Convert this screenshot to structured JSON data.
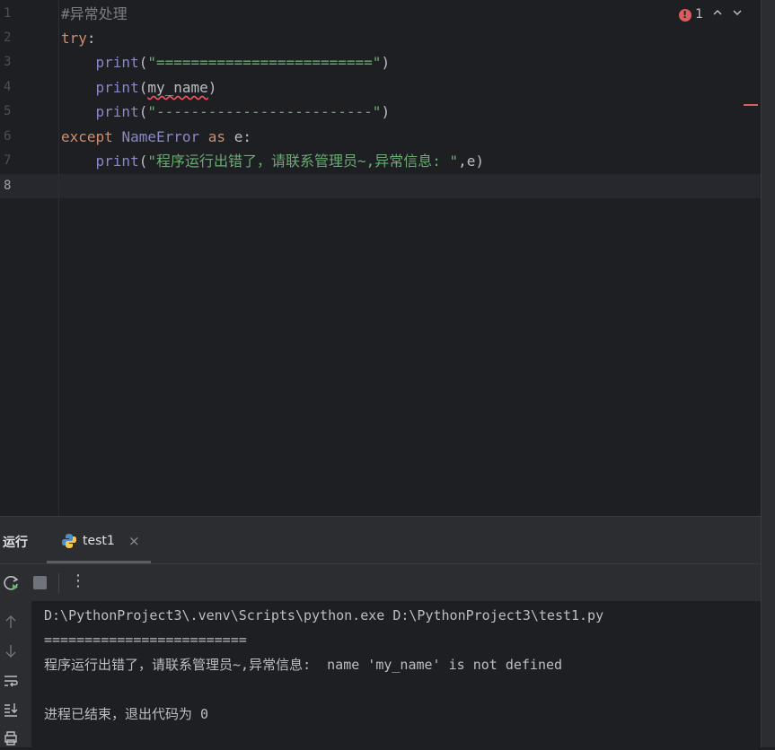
{
  "editor": {
    "line_numbers": [
      "1",
      "2",
      "3",
      "4",
      "5",
      "6",
      "7",
      "8"
    ],
    "lines": {
      "l1_comment": "#异常处理",
      "l2_kw": "try",
      "l2_colon": ":",
      "l3_fn": "print",
      "l3_open": "(",
      "l3_str": "\"=========================\"",
      "l3_close": ")",
      "l4_fn": "print",
      "l4_open": "(",
      "l4_var": "my_name",
      "l4_close": ")",
      "l5_fn": "print",
      "l5_open": "(",
      "l5_str": "\"-------------------------\"",
      "l5_close": ")",
      "l6_kw1": "except",
      "l6_cls": "NameError",
      "l6_kw2": "as",
      "l6_rest": "e:",
      "l7_fn": "print",
      "l7_open": "(",
      "l7_str": "\"程序运行出错了，请联系管理员~,异常信息: \"",
      "l7_rest": ",e)"
    },
    "inspections": {
      "error_count": "1",
      "error_glyph": "!"
    }
  },
  "tool_window": {
    "title": "运行",
    "tab_label": "test1",
    "tab_close": "×"
  },
  "toolbar": {
    "more": "⋮"
  },
  "console": {
    "lines": [
      "D:\\PythonProject3\\.venv\\Scripts\\python.exe D:\\PythonProject3\\test1.py",
      "=========================",
      "程序运行出错了，请联系管理员~,异常信息:  name 'my_name' is not defined",
      "",
      "进程已结束，退出代码为 0"
    ]
  },
  "icons": {
    "rerun": "rerun-icon",
    "stop": "stop-icon",
    "up": "arrow-up-icon",
    "down": "arrow-down-icon",
    "wrap": "soft-wrap-icon",
    "scroll_end": "scroll-to-end-icon",
    "print": "print-icon"
  },
  "colors": {
    "error": "#db5c5c",
    "keyword": "#cf8e6d",
    "string": "#6aab73",
    "builtin": "#8888c6"
  }
}
